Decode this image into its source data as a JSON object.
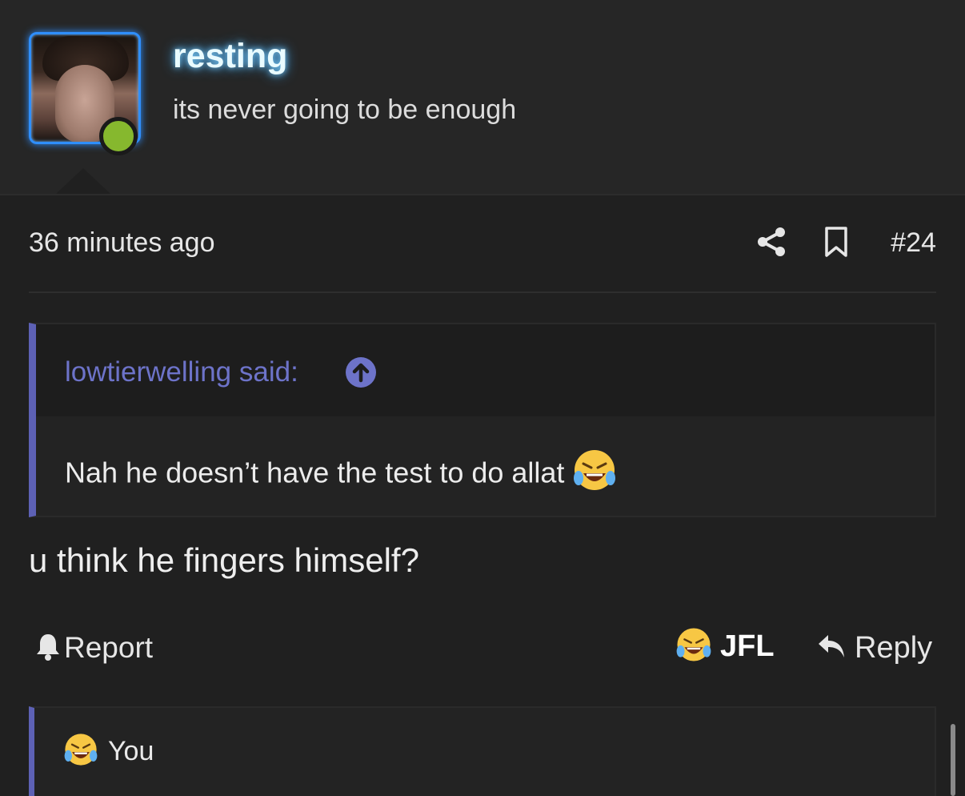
{
  "user": {
    "name": "resting",
    "title": "its never going to be enough",
    "status": "online"
  },
  "post": {
    "timestamp": "36 minutes ago",
    "number": "#24",
    "quote": {
      "author": "lowtierwelling said:",
      "text": "Nah he doesn’t have the test to do allat"
    },
    "message": "u think he fingers himself?"
  },
  "actions": {
    "report_label": "Report",
    "reaction_label": "JFL",
    "reply_label": "Reply"
  },
  "reactions": {
    "text": "You"
  },
  "icons": {
    "share": "share-icon",
    "bookmark": "bookmark-icon",
    "quote_jump": "arrow-up-circle-icon",
    "report": "bell-icon",
    "reply": "reply-arrow-icon",
    "reaction": "laughing-crying-emoji-icon"
  },
  "colors": {
    "accent": "#5d61b5",
    "online": "#86b82e",
    "avatar_glow": "#2f8fff"
  }
}
